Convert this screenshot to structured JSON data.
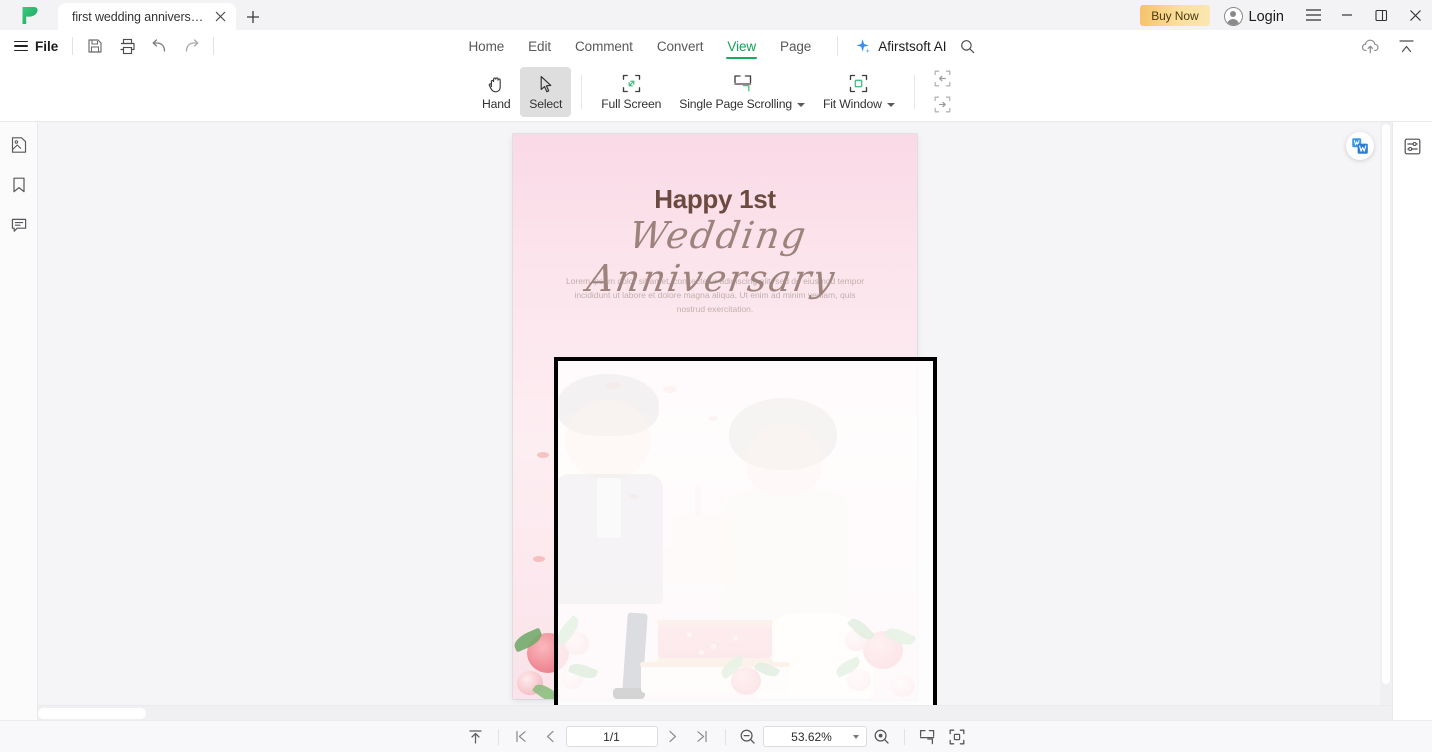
{
  "window": {
    "tab": {
      "title": "first wedding anniversar...",
      "close_label": "×"
    },
    "new_tab_label": "+",
    "buy_now_label": "Buy Now",
    "login_label": "Login",
    "minimize_label": "—",
    "restore_label": "❐",
    "close_label": "✕",
    "menu_label": "☰"
  },
  "menubar": {
    "file_label": "File",
    "quick_icons": [
      "save-icon",
      "print-icon",
      "undo-icon",
      "redo-icon"
    ],
    "tabs": [
      {
        "label": "Home",
        "active": false
      },
      {
        "label": "Edit",
        "active": false
      },
      {
        "label": "Comment",
        "active": false
      },
      {
        "label": "Convert",
        "active": false
      },
      {
        "label": "View",
        "active": true
      },
      {
        "label": "Page",
        "active": false
      }
    ],
    "ai_label": "Afirstsoft AI",
    "search_icon": "search-icon",
    "cloud_icon": "cloud-upload-icon",
    "collapse_icon": "collapse-ribbon-icon"
  },
  "ribbon": {
    "items": [
      {
        "label": "Hand",
        "icon": "hand-icon",
        "selected": false,
        "dropdown": false
      },
      {
        "label": "Select",
        "icon": "cursor-arrow-icon",
        "selected": true,
        "dropdown": false
      },
      {
        "label": "Full Screen",
        "icon": "full-screen-icon",
        "selected": false,
        "dropdown": false
      },
      {
        "label": "Single Page Scrolling",
        "icon": "page-scrolling-icon",
        "selected": false,
        "dropdown": true
      },
      {
        "label": "Fit Window",
        "icon": "fit-window-icon",
        "selected": false,
        "dropdown": true
      }
    ],
    "extra_icons": [
      "zoom-to-previous-icon",
      "zoom-to-next-icon"
    ]
  },
  "left_rail": {
    "items": [
      {
        "name": "thumbnails-icon",
        "title": "Thumbnails"
      },
      {
        "name": "bookmark-icon",
        "title": "Bookmarks"
      },
      {
        "name": "comment-icon",
        "title": "Comments"
      }
    ]
  },
  "right_rail": {
    "items": [
      {
        "name": "properties-panel-icon",
        "title": "Properties"
      }
    ]
  },
  "document": {
    "title_line": "Happy 1st",
    "script_line": "Wedding Anniversary",
    "body_text": "Lorem ipsum dolor sit amet, consectetur adipiscing elit, sed do eiusmod tempor incididunt ut labore et dolore magna aliqua. Ut enim ad minim veniam, quis nostrud exercitation.",
    "word_badge_icon": "convert-to-word-icon",
    "colors": {
      "card_top": "#f9d9e6",
      "card_bottom": "#fae3ea",
      "title_color": "#6b4a3f",
      "script_color": "#7a5e52",
      "overlay_border": "#000000"
    },
    "overlay_box": {
      "name": "selection-crop-box"
    }
  },
  "statusbar": {
    "scroll_top_icon": "scroll-to-top-icon",
    "first_page_icon": "first-page-icon",
    "prev_page_icon": "previous-page-icon",
    "page_value": "1/1",
    "next_page_icon": "next-page-icon",
    "last_page_icon": "last-page-icon",
    "zoom_out_icon": "zoom-out-icon",
    "zoom_value": "53.62%",
    "zoom_in_icon": "zoom-in-icon",
    "page_scroll_icon": "page-scrolling-icon",
    "fit_window_icon": "fit-window-icon"
  },
  "accent": {
    "green": "#19aa60",
    "buy_now": "#f5c26b",
    "ai_blue": "#3b8ef0"
  }
}
